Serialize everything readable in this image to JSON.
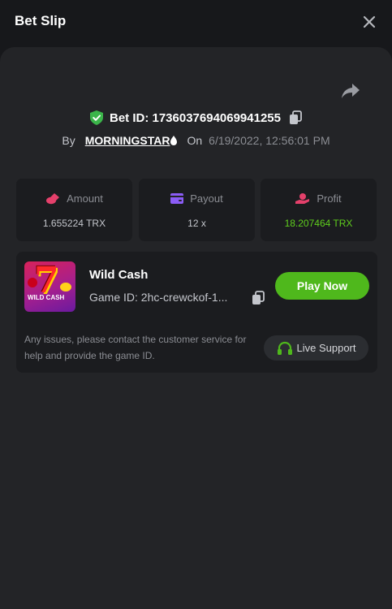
{
  "header": {
    "title": "Bet Slip"
  },
  "bet": {
    "id_text": "Bet ID: 1736037694069941255",
    "by_label": "By",
    "username": "MORNINGSTAR",
    "on_label": "On",
    "datetime": "6/19/2022, 12:56:01 PM"
  },
  "stats": [
    {
      "label": "Amount",
      "value": "1.655224 TRX",
      "icon": "coins-icon",
      "icon_color": "#e5406b"
    },
    {
      "label": "Payout",
      "value": "12 x",
      "icon": "wallet-icon",
      "icon_color": "#8b5cf6"
    },
    {
      "label": "Profit",
      "value": "18.207464 TRX",
      "icon": "hand-coin-icon",
      "icon_color": "#e5406b"
    }
  ],
  "game": {
    "name": "Wild Cash",
    "thumbnail_text": "WILD CASH",
    "id_text": "Game ID: 2hc-crewckof-1...",
    "play_label": "Play Now",
    "issues_text": "Any issues, please contact the customer service for help and provide the game ID.",
    "support_label": "Live Support"
  },
  "colors": {
    "accent_green": "#4fb81c",
    "profit_green": "#5fce1d",
    "shield_green": "#3bb54a"
  }
}
